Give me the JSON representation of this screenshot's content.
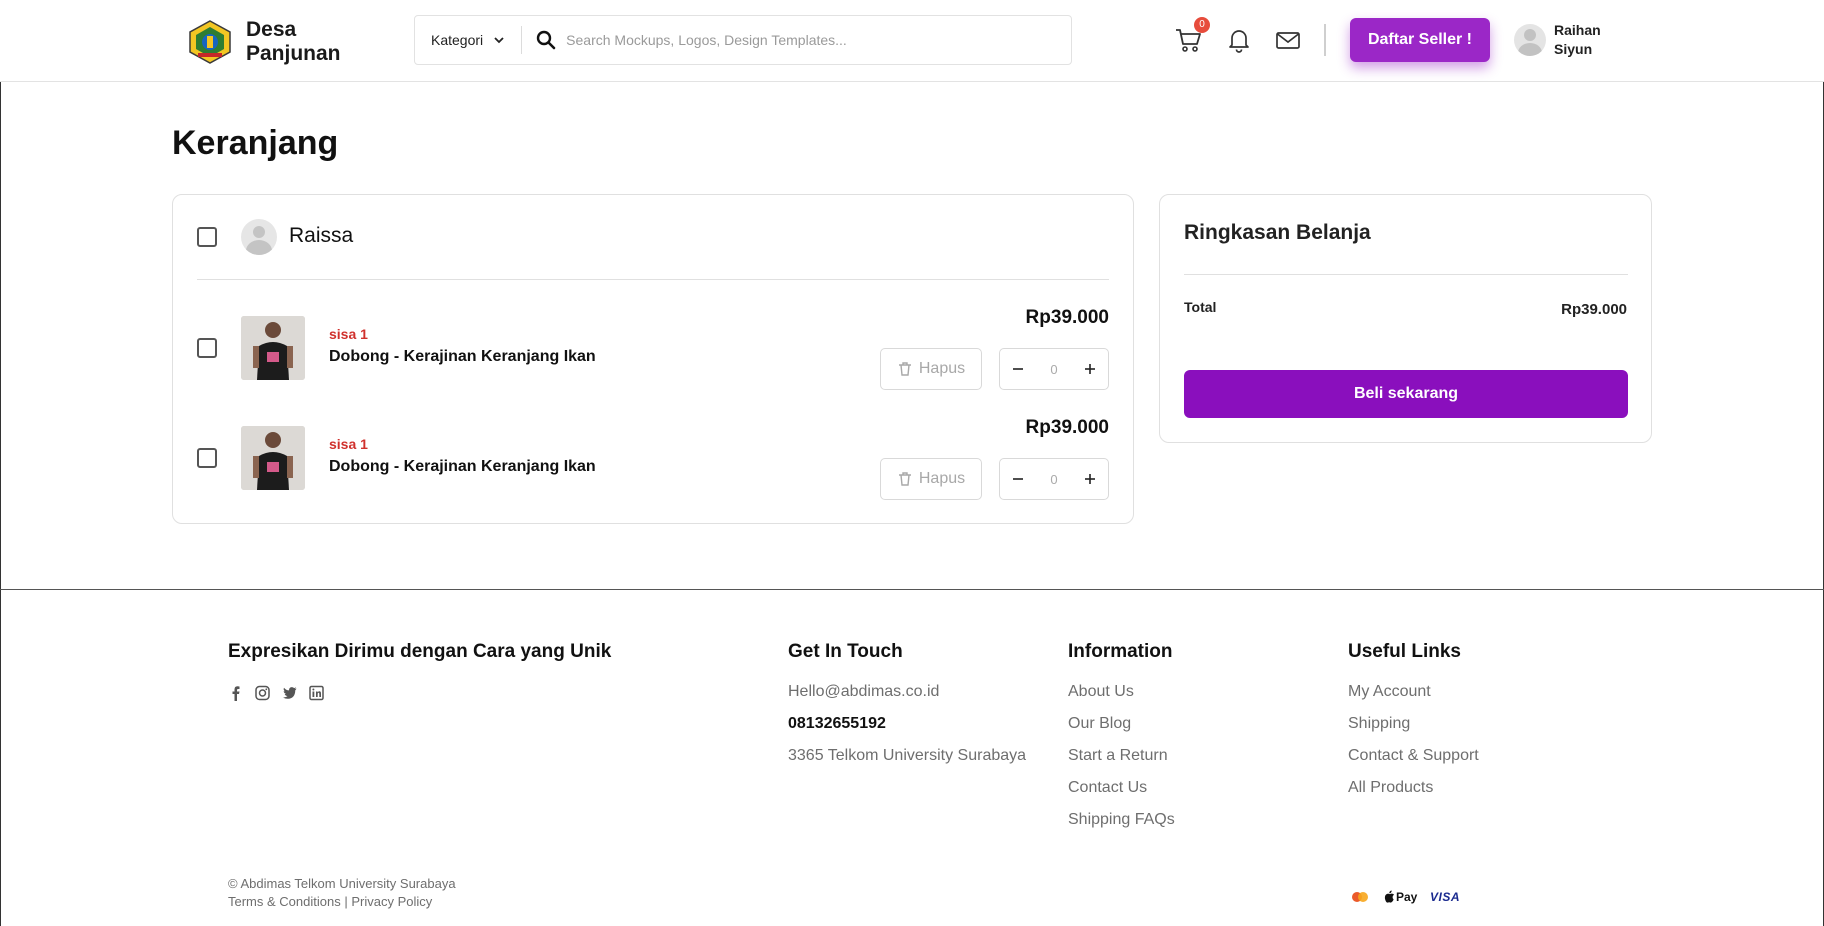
{
  "header": {
    "logo_line1": "Desa",
    "logo_line2": "Panjunan",
    "category_label": "Kategori",
    "search_placeholder": "Search Mockups, Logos, Design Templates...",
    "cart_count": "0",
    "seller_button": "Daftar Seller !",
    "user_first": "Raihan",
    "user_last": "Siyun",
    "icons": [
      "cart-icon",
      "bell-icon",
      "mail-icon",
      "search-icon",
      "chevron-down-icon"
    ],
    "accent_color": "#9b27c7"
  },
  "cart": {
    "title": "Keranjang",
    "seller_name": "Raissa",
    "items": [
      {
        "stock": "sisa 1",
        "name": "Dobong - Kerajinan Keranjang Ikan",
        "price": "Rp39.000",
        "delete_label": "Hapus",
        "quantity": "0"
      },
      {
        "stock": "sisa 1",
        "name": "Dobong - Kerajinan Keranjang Ikan",
        "price": "Rp39.000",
        "delete_label": "Hapus",
        "quantity": "0"
      }
    ]
  },
  "summary": {
    "title": "Ringkasan Belanja",
    "total_label": "Total",
    "total_value": "Rp39.000",
    "buy_button": "Beli sekarang",
    "button_color": "#8a0fbd"
  },
  "footer": {
    "tagline": "Expresikan Dirimu dengan Cara yang Unik",
    "social_icons": [
      "facebook-icon",
      "instagram-icon",
      "twitter-icon",
      "linkedin-icon"
    ],
    "contact": {
      "heading": "Get In Touch",
      "email": "Hello@abdimas.co.id",
      "phone": "08132655192",
      "address": "3365 Telkom University Surabaya"
    },
    "information": {
      "heading": "Information",
      "links": [
        "About Us",
        "Our Blog",
        "Start a Return",
        "Contact Us",
        "Shipping FAQs"
      ]
    },
    "useful": {
      "heading": "Useful Links",
      "links": [
        "My Account",
        "Shipping",
        "Contact & Support",
        "All Products"
      ]
    },
    "copyright": "© Abdimas Telkom University Surabaya",
    "terms": "Terms & Conditions",
    "separator": "|",
    "privacy": "Privacy Policy",
    "payment_icons": [
      "mastercard-icon",
      "apple-pay-icon",
      "visa-icon"
    ],
    "apple_pay_label": "Pay",
    "visa_label": "VISA"
  }
}
